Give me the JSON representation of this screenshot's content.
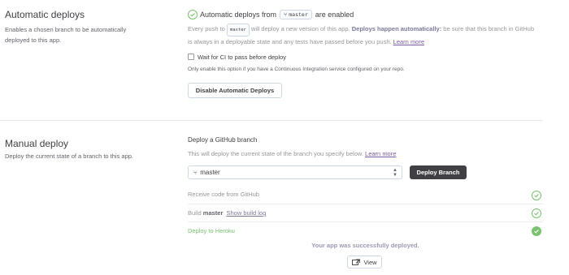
{
  "automatic_deploys": {
    "title": "Automatic deploys",
    "description": "Enables a chosen branch to be automatically deployed to this app.",
    "status_prefix": "Automatic deploys from",
    "branch": "master",
    "status_suffix": "are enabled",
    "desc_1": "Every push to",
    "desc_branch": "master",
    "desc_2": "will deploy a new version of this app.",
    "desc_bold": "Deploys happen automatically:",
    "desc_3": "be sure that this branch in GitHub is always in a deployable state and any tests have passed before you push.",
    "learn_more": "Learn more",
    "wait_ci_label": "Wait for CI to pass before deploy",
    "wait_ci_note": "Only enable this option if you have a Continuous Integration service configured on your repo.",
    "disable_button": "Disable Automatic Deploys"
  },
  "manual_deploy": {
    "title": "Manual deploy",
    "description": "Deploy the current state of a branch to this app.",
    "heading": "Deploy a GitHub branch",
    "desc": "This will deploy the current state of the branch you specify below.",
    "learn_more": "Learn more",
    "selected_branch": "master",
    "deploy_button": "Deploy Branch",
    "steps": {
      "receive": "Receive code from GitHub",
      "build_prefix": "Build",
      "build_branch": "master",
      "build_log_link": "Show build log",
      "deploy": "Deploy to Heroku"
    },
    "success_message": "Your app was successfully deployed.",
    "view_button": "View"
  },
  "colors": {
    "success": "#79c36f",
    "text": "#3f3f44",
    "muted": "#96969c",
    "link": "#79589f",
    "dark_button": "#3f3f44"
  },
  "icons": [
    "check-circle-icon",
    "branch-icon",
    "chevron-updown-icon",
    "external-link-icon"
  ]
}
